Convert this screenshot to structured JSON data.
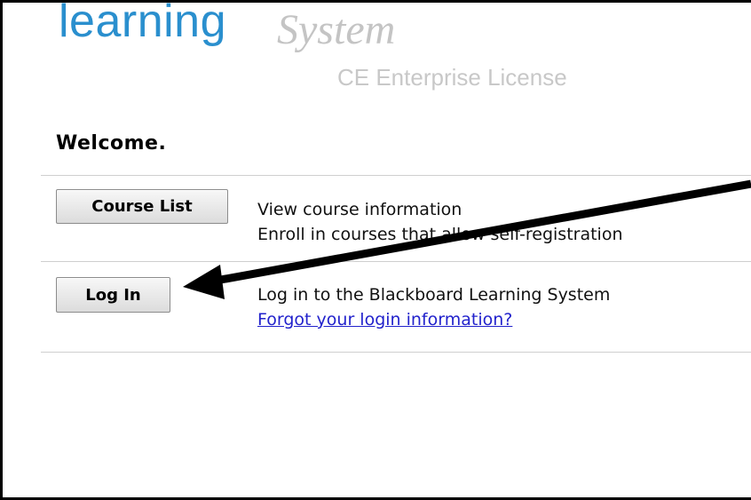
{
  "logo": {
    "word_learning": "learning",
    "word_system": "System",
    "license": "CE Enterprise License"
  },
  "welcome": "Welcome.",
  "actions": [
    {
      "button_label": "Course List",
      "lines": [
        "View course information",
        "Enroll in courses that allow self-registration"
      ]
    },
    {
      "button_label": "Log In",
      "line": "Log in to the Blackboard Learning System",
      "link": "Forgot your login information?"
    }
  ],
  "colors": {
    "logo_blue": "#2a8fce",
    "link_blue": "#2222cc",
    "annotation_arrow": "#000000"
  },
  "annotation": {
    "type": "arrow",
    "points_to": "Log In button"
  }
}
